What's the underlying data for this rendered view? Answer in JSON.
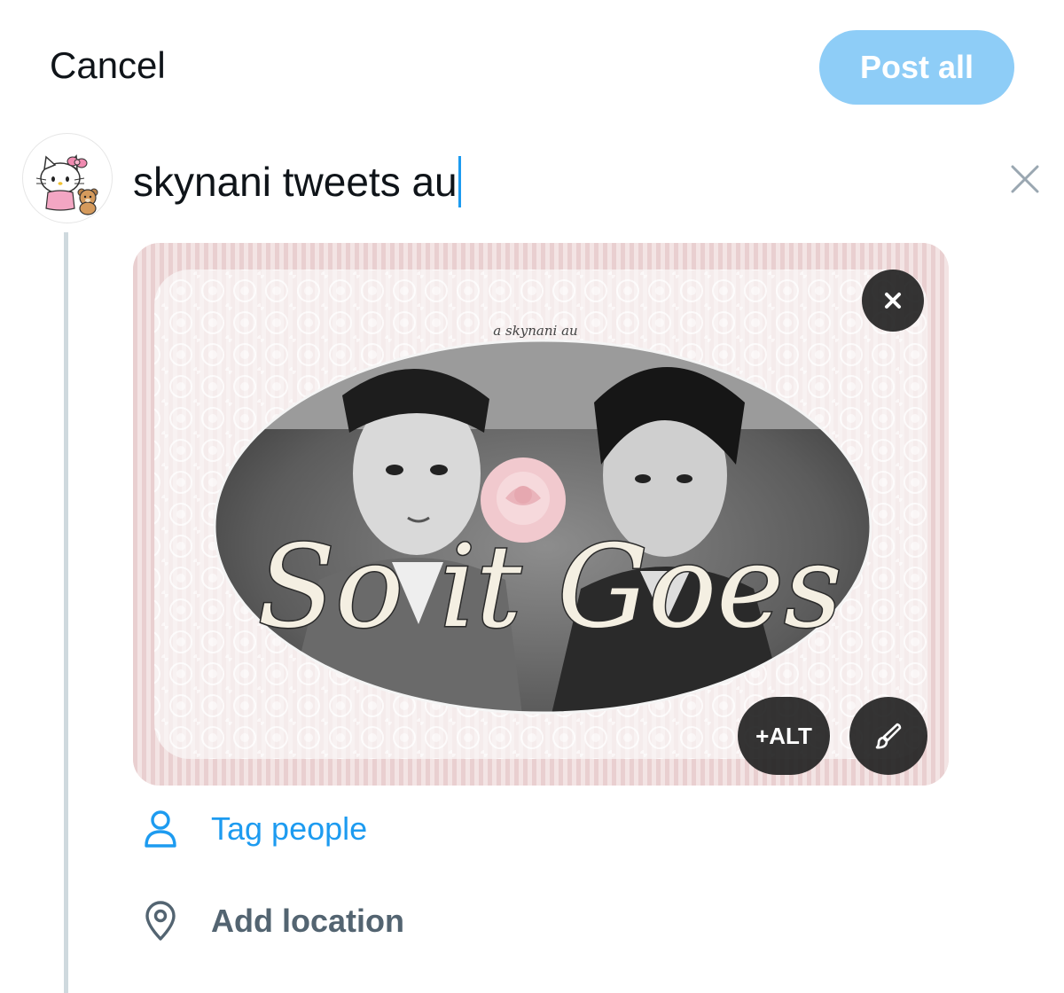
{
  "header": {
    "cancel_label": "Cancel",
    "post_all_label": "Post all"
  },
  "compose": {
    "text": "skynani tweets au",
    "accent_color": "#1d9bf0",
    "avatar_icon": "hello-kitty-avatar"
  },
  "media": {
    "caption": "a skynani au",
    "title": "So it Goes",
    "alt_label": "+ALT",
    "close_icon": "close-icon",
    "edit_icon": "paintbrush-icon"
  },
  "options": {
    "tag_people_label": "Tag people",
    "tag_people_icon": "person-icon",
    "add_location_label": "Add location",
    "add_location_icon": "location-pin-icon"
  },
  "colors": {
    "post_button": "#8ecdf7",
    "link": "#1d9bf0",
    "secondary_text": "#536471"
  }
}
